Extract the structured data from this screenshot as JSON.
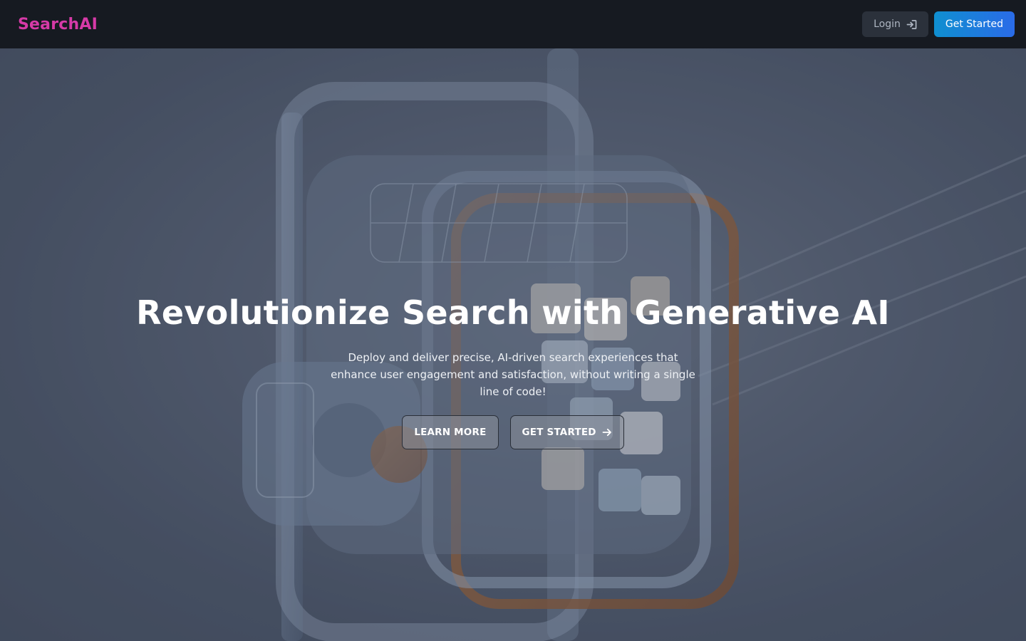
{
  "navbar": {
    "brand": "SearchAI",
    "login_label": "Login",
    "get_started_label": "Get Started"
  },
  "hero": {
    "title": "Revolutionize Search with Generative AI",
    "subtitle": "Deploy and deliver precise, AI-driven search experiences that enhance user engagement and satisfaction, without writing a single line of code!",
    "learn_more_label": "LEARN MORE",
    "get_started_label": "GET STARTED"
  },
  "colors": {
    "brand": "#d63aa7",
    "navbar_bg": "#161a21",
    "primary_gradient_start": "#0f8fd0",
    "primary_gradient_end": "#2a6be8"
  },
  "icons": {
    "login": "sign-in-icon",
    "get_started": "arrow-right-icon"
  }
}
